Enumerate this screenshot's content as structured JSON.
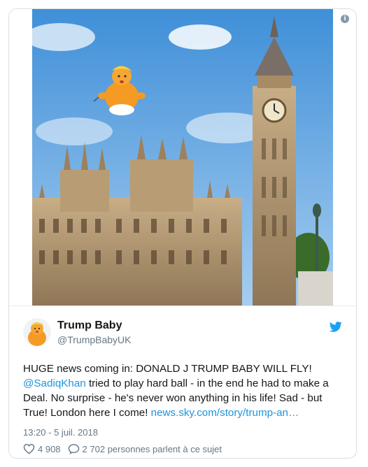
{
  "tweet": {
    "author_name": "Trump Baby",
    "author_handle": "@TrumpBabyUK",
    "text_part1": "HUGE news coming in: DONALD J TRUMP BABY WILL FLY! ",
    "mention": "@SadiqKhan",
    "text_part2": " tried to play hard ball - in the end he had to make a Deal. No surprise - he's never won anything in his life! Sad - but True! London here I come! ",
    "link": "news.sky.com/story/trump-an…",
    "timestamp": "13:20 - 5 juil. 2018",
    "likes": "4 908",
    "discussion": "2 702 personnes parlent à ce sujet"
  },
  "media": {
    "info_symbol": "i"
  },
  "icons": {
    "info": "info-icon",
    "twitter": "twitter-bird-icon",
    "like": "heart-icon",
    "reply": "speech-bubble-icon"
  },
  "colors": {
    "link": "#1b95e0",
    "twitter_blue": "#1da1f2",
    "text": "#14171a",
    "secondary": "#657786"
  }
}
